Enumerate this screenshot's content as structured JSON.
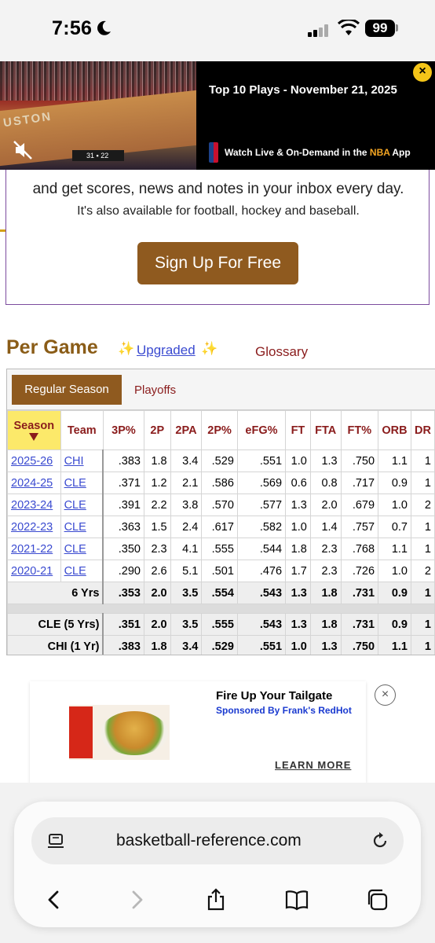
{
  "status_bar": {
    "time": "7:56",
    "battery": "99"
  },
  "video_ad": {
    "title": "Top 10 Plays - November 21, 2025",
    "cta_prefix": "Watch Live & On-Demand in the ",
    "cta_brand": "NBA",
    "cta_suffix": " App",
    "court_text": "USTON",
    "score_home": "31",
    "score_away": "22"
  },
  "newsletter": {
    "line1": "and get scores, news and notes in your inbox every day.",
    "line2": "It's also available for football, hockey and baseball.",
    "button": "Sign Up For Free"
  },
  "section": {
    "title": "Per Game",
    "upgraded": "Upgraded",
    "glossary": "Glossary"
  },
  "tabs": {
    "regular": "Regular Season",
    "playoffs": "Playoffs"
  },
  "table": {
    "headers": [
      "Season",
      "Team",
      "3P%",
      "2P",
      "2PA",
      "2P%",
      "eFG%",
      "FT",
      "FTA",
      "FT%",
      "ORB",
      "DR"
    ],
    "rows": [
      [
        "2025-26",
        "CHI",
        ".383",
        "1.8",
        "3.4",
        ".529",
        ".551",
        "1.0",
        "1.3",
        ".750",
        "1.1",
        "1"
      ],
      [
        "2024-25",
        "CLE",
        ".371",
        "1.2",
        "2.1",
        ".586",
        ".569",
        "0.6",
        "0.8",
        ".717",
        "0.9",
        "1"
      ],
      [
        "2023-24",
        "CLE",
        ".391",
        "2.2",
        "3.8",
        ".570",
        ".577",
        "1.3",
        "2.0",
        ".679",
        "1.0",
        "2"
      ],
      [
        "2022-23",
        "CLE",
        ".363",
        "1.5",
        "2.4",
        ".617",
        ".582",
        "1.0",
        "1.4",
        ".757",
        "0.7",
        "1"
      ],
      [
        "2021-22",
        "CLE",
        ".350",
        "2.3",
        "4.1",
        ".555",
        ".544",
        "1.8",
        "2.3",
        ".768",
        "1.1",
        "1"
      ],
      [
        "2020-21",
        "CLE",
        ".290",
        "2.6",
        "5.1",
        ".501",
        ".476",
        "1.7",
        "2.3",
        ".726",
        "1.0",
        "2"
      ]
    ],
    "totals": [
      [
        "6 Yrs",
        ".353",
        "2.0",
        "3.5",
        ".554",
        ".543",
        "1.3",
        "1.8",
        ".731",
        "0.9",
        "1"
      ],
      [
        "CLE (5 Yrs)",
        ".351",
        "2.0",
        "3.5",
        ".555",
        ".543",
        "1.3",
        "1.8",
        ".731",
        "0.9",
        "1"
      ],
      [
        "CHI (1 Yr)",
        ".383",
        "1.8",
        "3.4",
        ".529",
        ".551",
        "1.0",
        "1.3",
        ".750",
        "1.1",
        "1"
      ]
    ]
  },
  "sponsored_ad": {
    "title": "Fire Up Your Tailgate",
    "sponsor": "Sponsored By Frank's RedHot",
    "cta": "LEARN MORE"
  },
  "browser": {
    "url": "basketball-reference.com"
  },
  "colors": {
    "brand_brown": "#8f5a1f",
    "link_blue": "#3a4ad0",
    "header_red": "#8a1c1c",
    "season_highlight": "#fce96a"
  }
}
